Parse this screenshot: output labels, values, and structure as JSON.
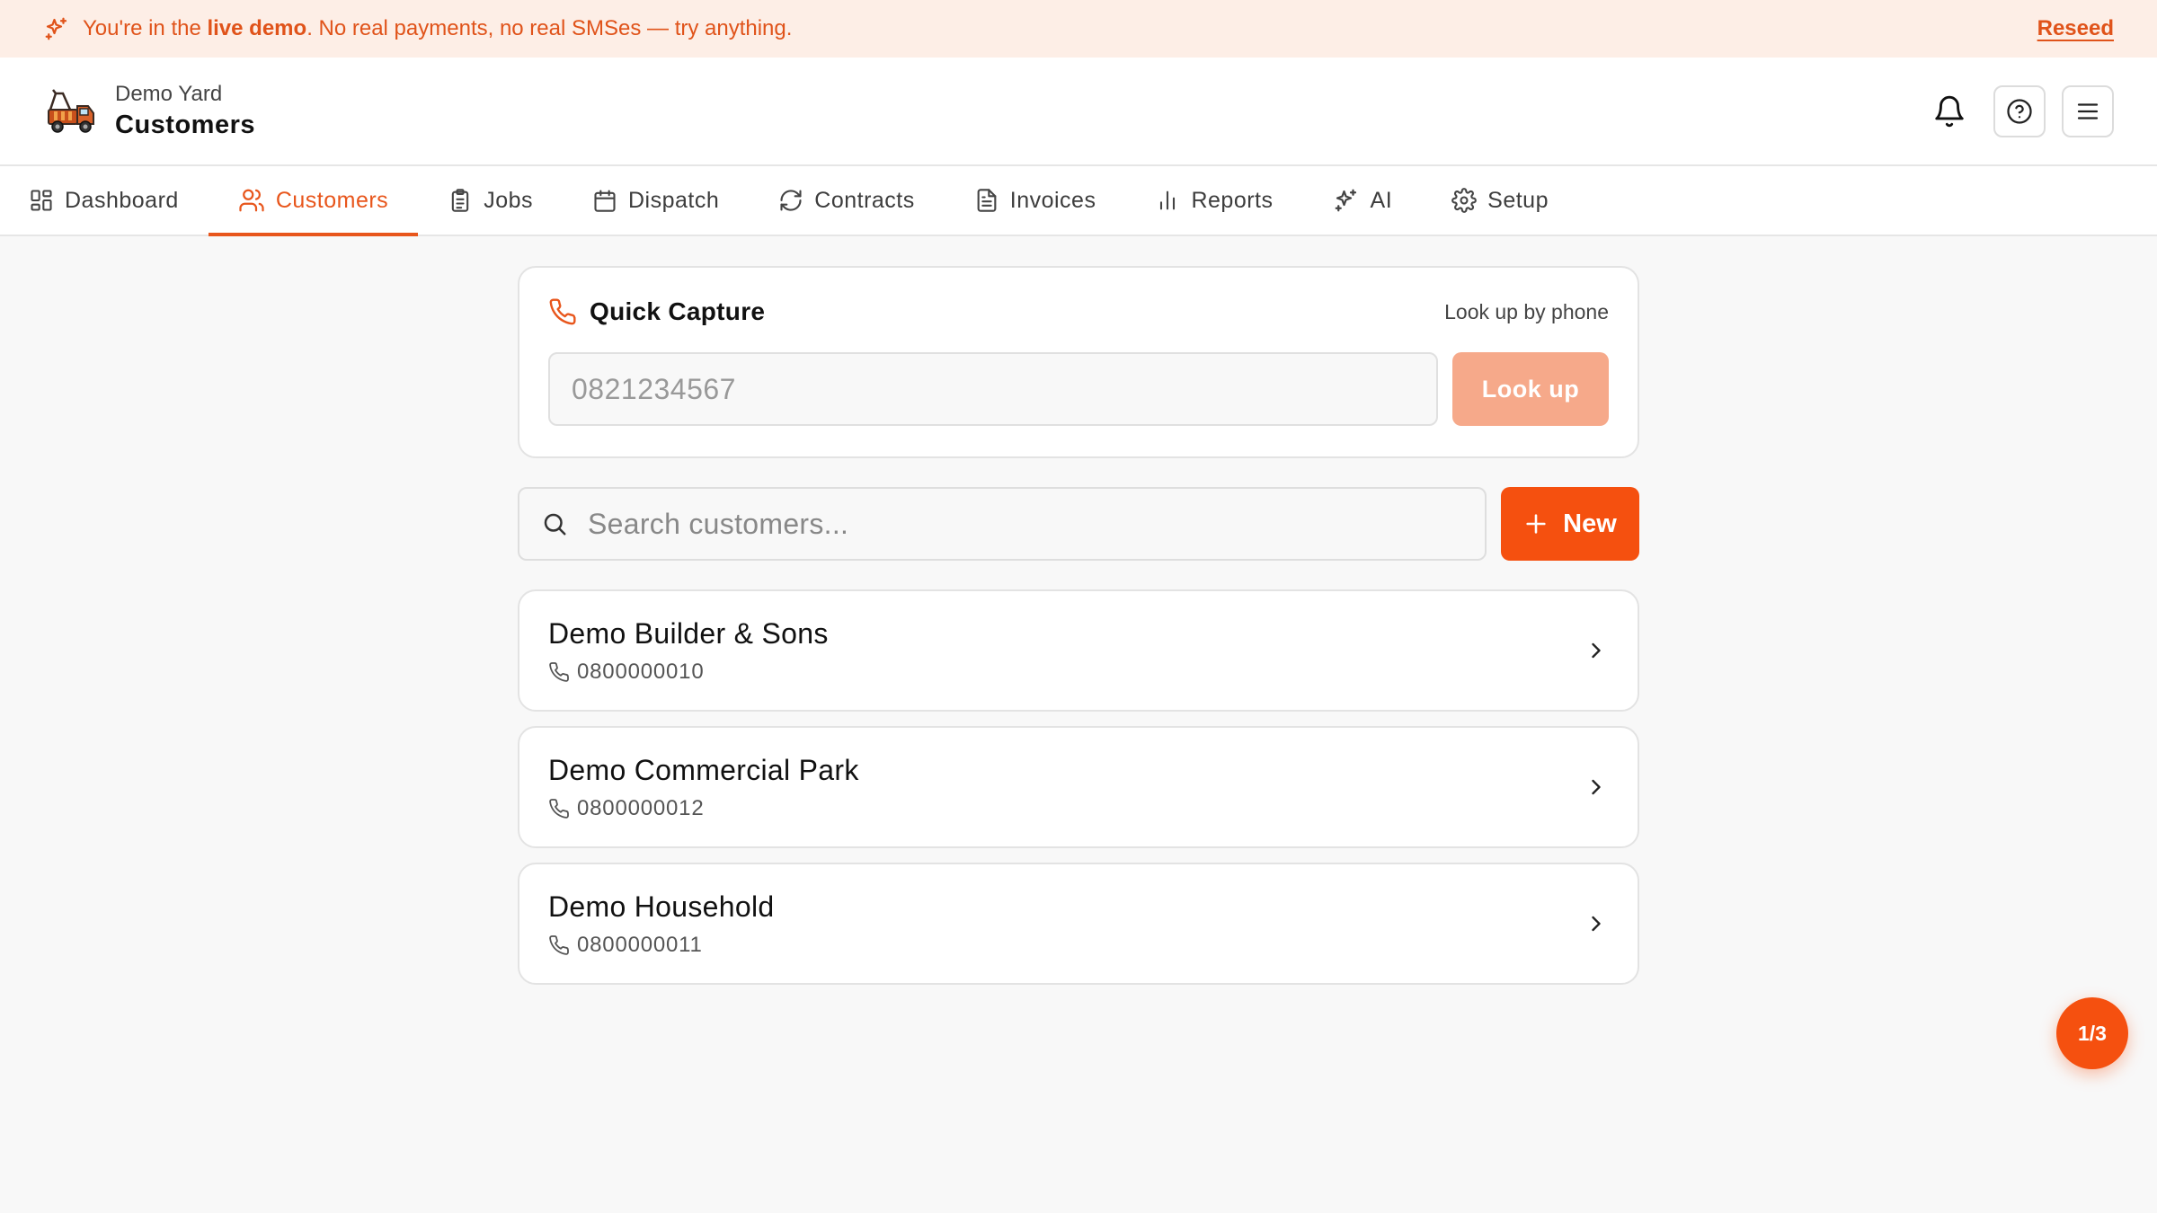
{
  "banner": {
    "prefix": "You're in the ",
    "highlight": "live demo",
    "suffix": ". No real payments, no real SMSes — try anything.",
    "action": "Reseed"
  },
  "header": {
    "org": "Demo Yard",
    "title": "Customers"
  },
  "nav": {
    "tabs": [
      {
        "label": "Dashboard",
        "icon": "dashboard-icon"
      },
      {
        "label": "Customers",
        "icon": "users-icon",
        "active": true
      },
      {
        "label": "Jobs",
        "icon": "clipboard-icon"
      },
      {
        "label": "Dispatch",
        "icon": "calendar-icon"
      },
      {
        "label": "Contracts",
        "icon": "refresh-icon"
      },
      {
        "label": "Invoices",
        "icon": "document-icon"
      },
      {
        "label": "Reports",
        "icon": "bar-chart-icon"
      },
      {
        "label": "AI",
        "icon": "sparkles-icon"
      },
      {
        "label": "Setup",
        "icon": "gear-icon"
      }
    ]
  },
  "quick_capture": {
    "title": "Quick Capture",
    "hint": "Look up by phone",
    "placeholder": "0821234567",
    "button": "Look up"
  },
  "search": {
    "placeholder": "Search customers...",
    "new_button": "New"
  },
  "customers": [
    {
      "name": "Demo Builder & Sons",
      "phone": "0800000010"
    },
    {
      "name": "Demo Commercial Park",
      "phone": "0800000012"
    },
    {
      "name": "Demo Household",
      "phone": "0800000011"
    }
  ],
  "fab": {
    "label": "1/3"
  },
  "colors": {
    "accent": "#f5500f",
    "banner_bg": "#fdeee6",
    "disabled_button": "#f6a98a"
  }
}
